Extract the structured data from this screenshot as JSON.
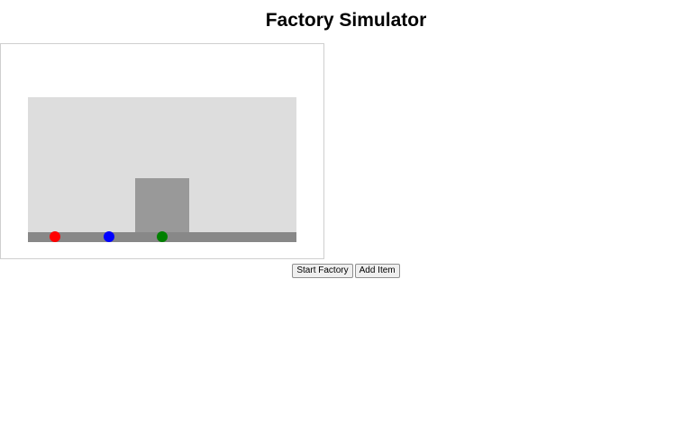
{
  "page": {
    "title": "Factory Simulator"
  },
  "factory": {
    "floor_color": "#dddddd",
    "machine_color": "#999999",
    "conveyor_color": "#888888",
    "items": [
      {
        "name": "red-item",
        "color": "#ff0000"
      },
      {
        "name": "blue-item",
        "color": "#0000ff"
      },
      {
        "name": "green-item",
        "color": "#008000"
      }
    ]
  },
  "controls": {
    "start_label": "Start Factory",
    "add_label": "Add Item"
  }
}
